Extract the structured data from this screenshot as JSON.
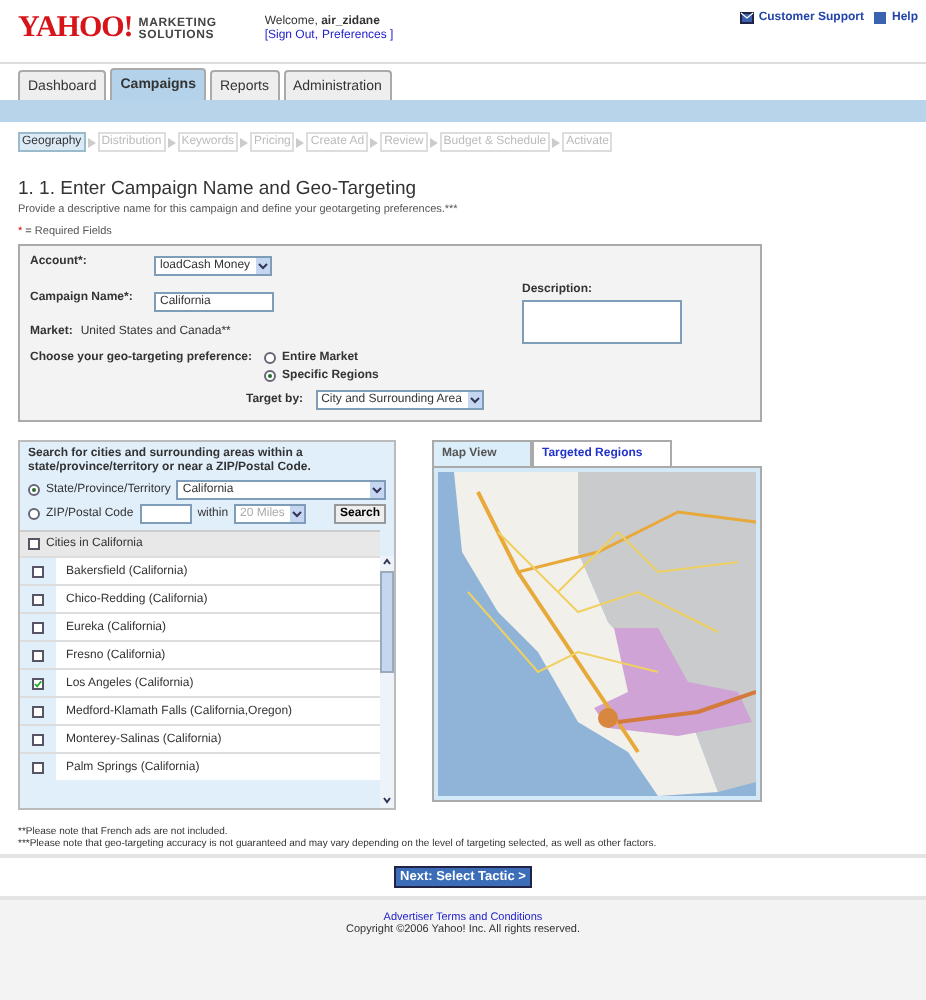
{
  "header": {
    "logo": "YAHOO!",
    "logo_sub": [
      "MARKETING",
      "SOLUTIONS"
    ],
    "welcome": "Welcome,",
    "user": "air_zidane",
    "account_links": [
      {
        "label": "[Sign Out,"
      },
      {
        "label": "Preferences ]"
      }
    ],
    "support": "Customer Support",
    "help": "Help"
  },
  "tabs": [
    {
      "label": "Dashboard",
      "selected": false
    },
    {
      "label": "Campaigns",
      "selected": true
    },
    {
      "label": "Reports",
      "selected": false
    },
    {
      "label": "Administration",
      "selected": false
    }
  ],
  "steps": [
    {
      "label": "Geography",
      "selected": true
    },
    {
      "label": "Distribution",
      "selected": false
    },
    {
      "label": "Keywords",
      "selected": false
    },
    {
      "label": "Pricing",
      "selected": false
    },
    {
      "label": "Create Ad",
      "selected": false
    },
    {
      "label": "Review",
      "selected": false
    },
    {
      "label": "Budget & Schedule",
      "selected": false
    },
    {
      "label": "Activate",
      "selected": false
    }
  ],
  "title": "1. 1. Enter Campaign Name and Geo-Targeting",
  "intro": "Provide a descriptive name for this campaign and define your geotargeting preferences.***",
  "required_note": {
    "mark": "*",
    "text": "= Required Fields"
  },
  "form": {
    "account_label": "Account*:",
    "account_value": "loadCash Money",
    "name_label": "Campaign Name*:",
    "name_value": "California",
    "market_label": "Market:",
    "market_value": "United States and Canada**",
    "description_label": "Description:",
    "pref_label": "Choose your geo-targeting preference:",
    "pref_options": [
      {
        "label": "Entire Market",
        "selected": false
      },
      {
        "label": "Specific Regions",
        "selected": true
      }
    ],
    "target_label": "Target by:",
    "target_value": "City and Surrounding Area"
  },
  "search_panel": {
    "intro": "Search for cities and surrounding areas within a state/province/territory or near a ZIP/Postal Code.",
    "modes": [
      {
        "label": "State/Province/Territory",
        "selected": true,
        "kind": "state",
        "value": "California"
      },
      {
        "label": "ZIP/Postal Code",
        "selected": false,
        "kind": "zip",
        "within": "within",
        "distance": "20 Miles"
      }
    ],
    "search_button": "Search",
    "list_header": {
      "label": "Cities in California",
      "checked": false
    },
    "cities": [
      {
        "name": "Bakersfield (California)",
        "checked": false
      },
      {
        "name": "Chico-Redding (California)",
        "checked": false
      },
      {
        "name": "Eureka (California)",
        "checked": false
      },
      {
        "name": "Fresno (California)",
        "checked": false
      },
      {
        "name": "Los Angeles (California)",
        "checked": true
      },
      {
        "name": "Medford-Klamath Falls (California,Oregon)",
        "checked": false
      },
      {
        "name": "Monterey-Salinas (California)",
        "checked": false
      },
      {
        "name": "Palm Springs (California)",
        "checked": false
      }
    ]
  },
  "map_tabs": [
    {
      "label": "Map View",
      "selected": true
    },
    {
      "label": "Targeted Regions",
      "selected": false
    }
  ],
  "notes": [
    "**Please note that French ads are not included.",
    "***Please note that geo-targeting accuracy is not guaranteed and may vary depending on the level of targeting selected, as well as other factors."
  ],
  "next_button": "Next: Select Tactic >",
  "footer": {
    "link": "Advertiser Terms and Conditions",
    "copyright": "Copyright ©2006 Yahoo! Inc. All rights reserved."
  }
}
